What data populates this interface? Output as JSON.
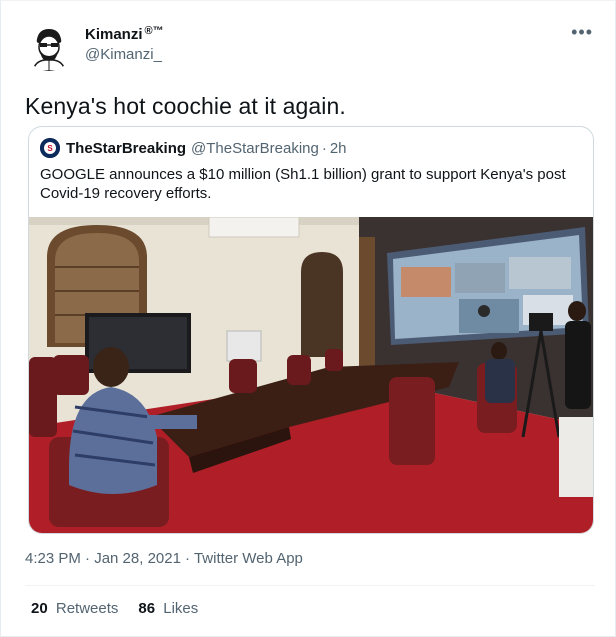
{
  "author": {
    "display_name": "Kimanzi",
    "verified_mark": "®™",
    "handle": "@Kimanzi_",
    "avatar_icon": "cartoon-portrait-avatar"
  },
  "more_icon": "more-options-icon",
  "tweet_text": "Kenya's hot coochie at it again.",
  "quoted_tweet": {
    "display_name": "TheStarBreaking",
    "handle": "@TheStarBreaking",
    "separator": "·",
    "time": "2h",
    "text": "GOOGLE announces a $10 million (Sh1.1 billion) grant to support Kenya's post Covid-19 recovery efforts.",
    "photo_icon": "virtual-meeting-photo"
  },
  "meta": {
    "timestamp": "4:23 PM · Jan 28, 2021",
    "separator": "·",
    "source": "Twitter Web App"
  },
  "stats": {
    "retweets_count": "20",
    "retweets_label": "Retweets",
    "likes_count": "86",
    "likes_label": "Likes"
  }
}
